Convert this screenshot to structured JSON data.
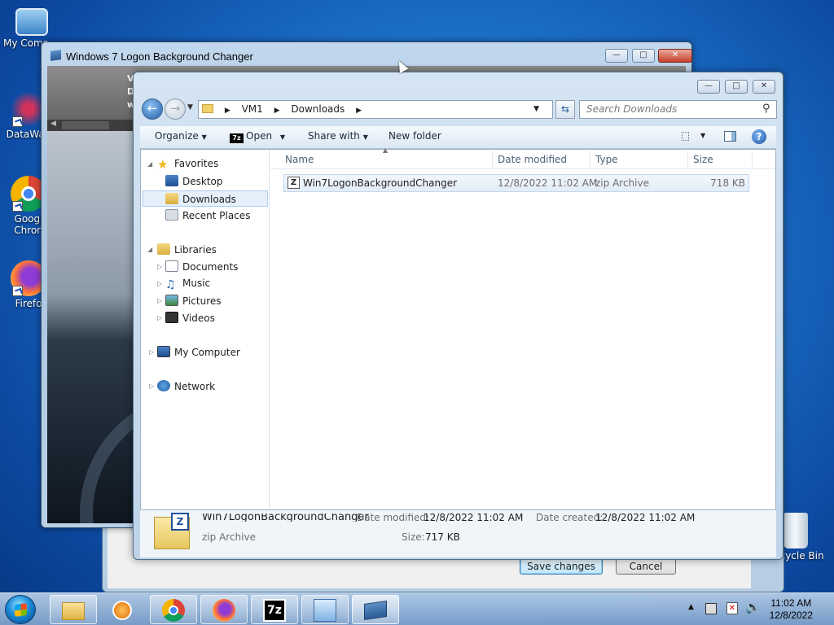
{
  "desktop": {
    "icons": [
      {
        "label": "My Comp",
        "icon": "computer-icon"
      },
      {
        "label": "DataWag",
        "icon": "datawag-icon"
      },
      {
        "label": "Googl Chron",
        "icon": "chrome-icon"
      },
      {
        "label": "Firefo",
        "icon": "firefox-icon"
      },
      {
        "label": "Recycle Bin",
        "icon": "recycle-bin-icon"
      }
    ]
  },
  "main_window": {
    "title": "Windows 7 Logon Background Changer",
    "strip_text": [
      "V",
      "D",
      "w"
    ]
  },
  "app_dialog": {
    "save_label": "Save changes",
    "cancel_label": "Cancel"
  },
  "file_dialog": {
    "breadcrumb": [
      "VM1",
      "Downloads"
    ],
    "search_placeholder": "Search Downloads",
    "toolbar": {
      "organize": "Organize",
      "open": "Open",
      "share_with": "Share with",
      "new_folder": "New folder"
    },
    "nav": {
      "favorites": "Favorites",
      "desktop": "Desktop",
      "downloads": "Downloads",
      "recent_places": "Recent Places",
      "libraries": "Libraries",
      "documents": "Documents",
      "music": "Music",
      "pictures": "Pictures",
      "videos": "Videos",
      "my_computer": "My Computer",
      "network": "Network"
    },
    "columns": {
      "name": "Name",
      "date_modified": "Date modified",
      "type": "Type",
      "size": "Size"
    },
    "files": [
      {
        "name": "Win7LogonBackgroundChanger",
        "date": "12/8/2022 11:02 AM",
        "type": "zip Archive",
        "size": "718 KB"
      }
    ],
    "details": {
      "name": "Win7LogonBackgroundChanger",
      "date_modified_label": "Date modified:",
      "date_modified": "12/8/2022 11:02 AM",
      "date_created_label": "Date created:",
      "date_created": "12/8/2022 11:02 AM",
      "type": "zip Archive",
      "size_label": "Size:",
      "size": "717 KB"
    }
  },
  "taskbar": {
    "time": "11:02 AM",
    "date": "12/8/2022"
  },
  "colors": {
    "desktop": "#1c6fc8",
    "accent": "#3c7fb1"
  }
}
